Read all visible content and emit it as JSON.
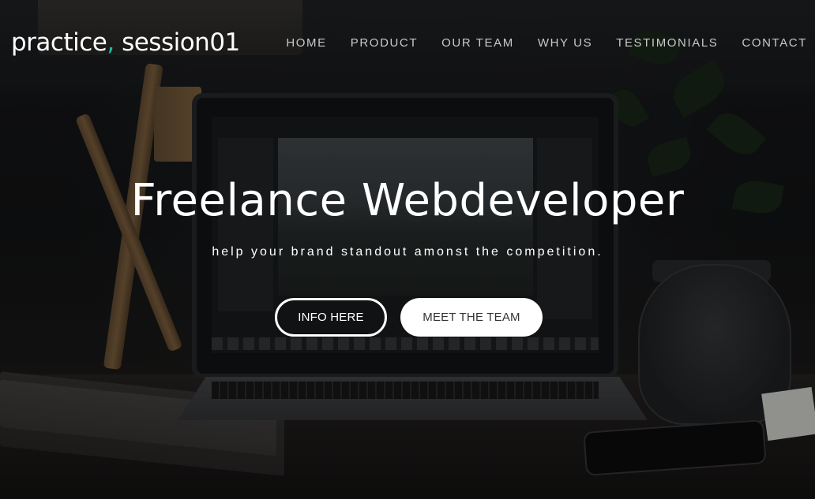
{
  "brand": {
    "name_part1": "practice",
    "comma": ",",
    "name_part2": " session01",
    "accent_color": "#1abc9c"
  },
  "nav": {
    "items": [
      {
        "label": "HOME"
      },
      {
        "label": "PRODUCT"
      },
      {
        "label": "OUR TEAM"
      },
      {
        "label": "WHY US"
      },
      {
        "label": "TESTIMONIALS"
      },
      {
        "label": "CONTACT"
      }
    ]
  },
  "hero": {
    "headline": "Freelance Webdeveloper",
    "subline": "help your brand standout amonst the competition.",
    "primary_button": "INFO HERE",
    "secondary_button": "MEET THE TEAM"
  },
  "colors": {
    "text": "#ffffff",
    "nav_text": "#c9c9c9",
    "button_solid_bg": "#ffffff",
    "button_solid_text": "#333333"
  }
}
